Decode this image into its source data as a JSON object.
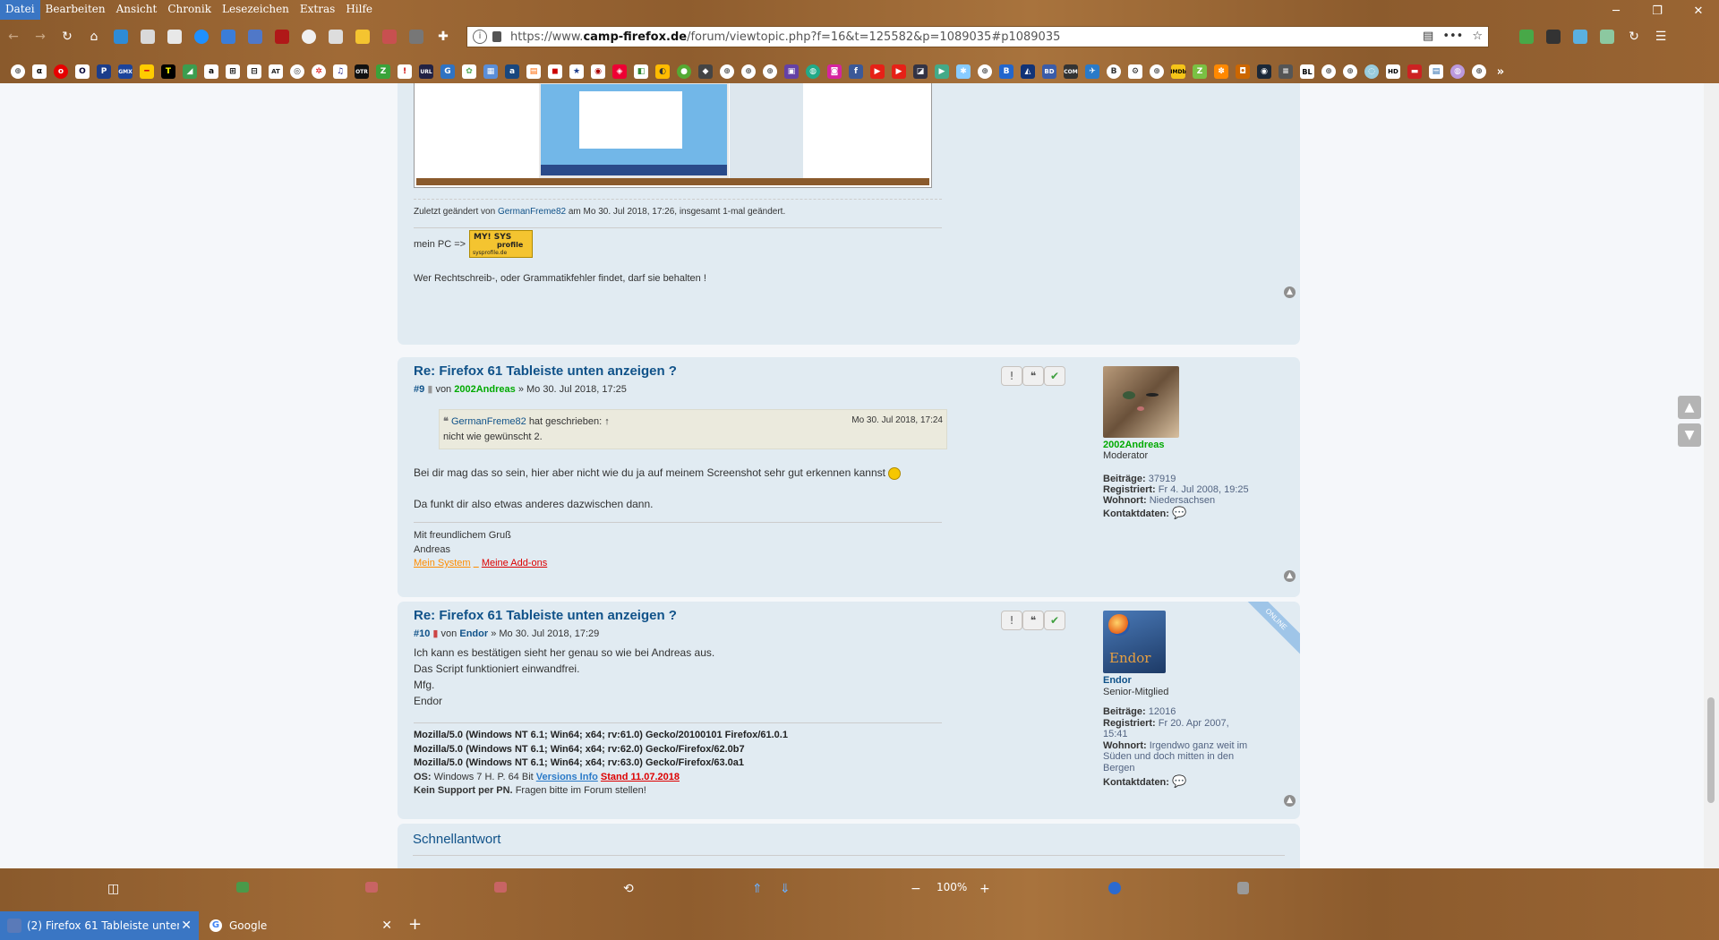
{
  "menu": [
    "Datei",
    "Bearbeiten",
    "Ansicht",
    "Chronik",
    "Lesezeichen",
    "Extras",
    "Hilfe"
  ],
  "url": {
    "prefix": "https://www.",
    "host": "camp-firefox.de",
    "path": "/forum/viewtopic.php?f=16&t=125582&p=1089035#p1089035"
  },
  "post8": {
    "edited_prefix": "Zuletzt geändert von",
    "edited_user": "GermanFreme82",
    "edited_suffix": "am Mo 30. Jul 2018, 17:26, insgesamt 1-mal geändert.",
    "pc_label": "mein PC =>",
    "badge_line1": "MY! SYS",
    "badge_line2": "profile",
    "badge_line3": "sysprofile.de",
    "closing": "Wer Rechtschreib-, oder Grammatikfehler findet, darf sie behalten !"
  },
  "post9": {
    "title": "Re: Firefox 61 Tableiste unten anzeigen ?",
    "number": "#9",
    "by": "von",
    "author": "2002Andreas",
    "date": "» Mo 30. Jul 2018, 17:25",
    "quote_user": "GermanFreme82",
    "quote_wrote": "hat geschrieben: ↑",
    "quote_date": "Mo 30. Jul 2018, 17:24",
    "quote_text": "nicht wie gewünscht 2.",
    "line1": "Bei dir mag das so sein, hier aber nicht wie du ja auf meinem Screenshot sehr gut erkennen kannst",
    "line2": "Da funkt dir also etwas anderes dazwischen dann.",
    "sig1": "Mit freundlichem Gruß",
    "sig2": "Andreas",
    "sig_link1": "Mein System",
    "sig_link2": "Meine Add-ons",
    "profile": {
      "name": "2002Andreas",
      "rank": "Moderator",
      "posts_label": "Beiträge:",
      "posts": "37919",
      "reg_label": "Registriert:",
      "reg": "Fr 4. Jul 2008, 19:25",
      "loc_label": "Wohnort:",
      "loc": "Niedersachsen",
      "contact_label": "Kontaktdaten:"
    }
  },
  "post10": {
    "title": "Re: Firefox 61 Tableiste unten anzeigen ?",
    "number": "#10",
    "by": "von",
    "author": "Endor",
    "date": "» Mo 30. Jul 2018, 17:29",
    "online": "ONLINE",
    "lines": [
      "Ich kann es bestätigen sieht her genau so wie bei Andreas aus.",
      "Das Script funktioniert einwandfrei.",
      "Mfg.",
      "Endor"
    ],
    "ua1": "Mozilla/5.0 (Windows NT 6.1; Win64; x64; rv:61.0) Gecko/20100101 Firefox/61.0.1",
    "ua2": "Mozilla/5.0 (Windows NT 6.1; Win64; x64; rv:62.0) Gecko/Firefox/62.0b7",
    "ua3": "Mozilla/5.0 (Windows NT 6.1; Win64; x64; rv:63.0) Gecko/Firefox/63.0a1",
    "os_label": "OS:",
    "os": "Windows 7 H. P. 64 Bit",
    "versions_link": "Versions Info",
    "stand_link": "Stand 11.07.2018",
    "support_bold": "Kein Support per PN.",
    "support_rest": "Fragen bitte im Forum stellen!",
    "avatar_text": "Endor",
    "profile": {
      "name": "Endor",
      "rank": "Senior-Mitglied",
      "posts_label": "Beiträge:",
      "posts": "12016",
      "reg_label": "Registriert:",
      "reg": "Fr 20. Apr 2007, 15:41",
      "loc_label": "Wohnort:",
      "loc": "Irgendwo ganz weit im Süden und doch mitten in den Bergen",
      "contact_label": "Kontaktdaten:"
    }
  },
  "quickreply": "Schnellantwort",
  "bottom": {
    "zoom": "100%",
    "zoom_out": "−",
    "zoom_in": "+"
  },
  "tabs": [
    {
      "label": "(2) Firefox 61 Tableiste unten"
    },
    {
      "label": "Google"
    }
  ],
  "colors": {
    "wood": "#8f5d2e",
    "link": "#105289",
    "accent_active": "#3a76c4",
    "panel": "#e1ebf2"
  }
}
